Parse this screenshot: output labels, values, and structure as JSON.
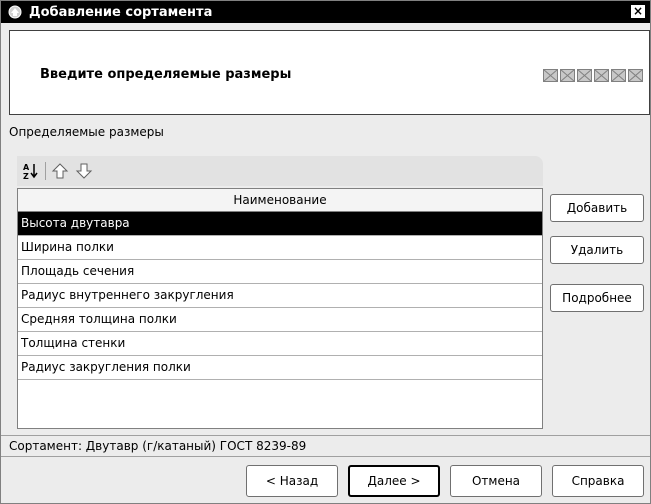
{
  "window": {
    "title": "Добавление сортамента",
    "close_label": "×"
  },
  "header": {
    "title": "Введите определяемые размеры",
    "steps_total": 6
  },
  "section": {
    "label": "Определяемые размеры"
  },
  "toolbar": {
    "icons": [
      "sort-az-icon",
      "arrow-up-icon",
      "arrow-down-icon"
    ]
  },
  "grid": {
    "column_header": "Наименование",
    "rows": [
      "Высота двутавра",
      "Ширина полки",
      "Площадь сечения",
      "Радиус внутреннего закругления",
      "Средняя толщина полки",
      "Толщина стенки",
      "Радиус закругления полки"
    ],
    "selected_index": 0
  },
  "side_buttons": {
    "add": "Добавить",
    "delete": "Удалить",
    "details": "Подробнее"
  },
  "status": {
    "text": "Сортамент: Двутавр (г/катаный) ГОСТ 8239-89"
  },
  "footer": {
    "back": "< Назад",
    "next": "Далее >",
    "cancel": "Отмена",
    "help": "Справка"
  }
}
